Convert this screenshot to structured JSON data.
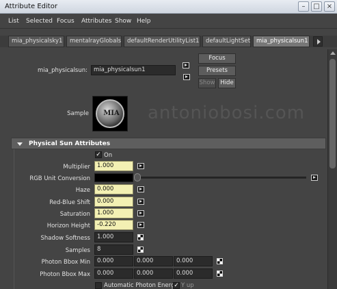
{
  "window": {
    "title": "Attribute Editor"
  },
  "menubar": [
    "List",
    "Selected",
    "Focus",
    "Attributes",
    "Show",
    "Help"
  ],
  "tabs": [
    "mia_physicalsky1",
    "mentalrayGlobals",
    "defaultRenderUtilityList1",
    "defaultLightSet",
    "mia_physicalsun1"
  ],
  "node": {
    "label": "mia_physicalsun:",
    "value": "mia_physicalsun1",
    "focus": "Focus",
    "presets": "Presets",
    "show": "Show",
    "hide": "Hide"
  },
  "sample": {
    "label": "Sample",
    "ball_text": "MIA"
  },
  "watermark": "antoniobosi.com",
  "section": {
    "title": "Physical Sun Attributes"
  },
  "attributes": {
    "on": {
      "label": "On",
      "checked": true
    },
    "multiplier": {
      "label": "Multiplier",
      "value": "1.000"
    },
    "rgb_unit_conversion": {
      "label": "RGB Unit Conversion",
      "color": "#000000"
    },
    "haze": {
      "label": "Haze",
      "value": "0.000"
    },
    "red_blue_shift": {
      "label": "Red-Blue Shift",
      "value": "0.000"
    },
    "saturation": {
      "label": "Saturation",
      "value": "1.000"
    },
    "horizon_height": {
      "label": "Horizon Height",
      "value": "-0.220"
    },
    "shadow_softness": {
      "label": "Shadow Softness",
      "value": "1.000"
    },
    "samples": {
      "label": "Samples",
      "value": "8"
    },
    "photon_bbox_min": {
      "label": "Photon Bbox Min",
      "values": [
        "0.000",
        "0.000",
        "0.000"
      ]
    },
    "photon_bbox_max": {
      "label": "Photon Bbox Max",
      "values": [
        "0.000",
        "0.000",
        "0.000"
      ]
    },
    "automatic_photon_energy": {
      "label": "Automatic Photon Energy",
      "checked": false
    },
    "y_up": {
      "label": "Y up",
      "checked": true
    }
  },
  "colors": {
    "yellow_field": "#f3f0b3",
    "panel": "#444444"
  }
}
